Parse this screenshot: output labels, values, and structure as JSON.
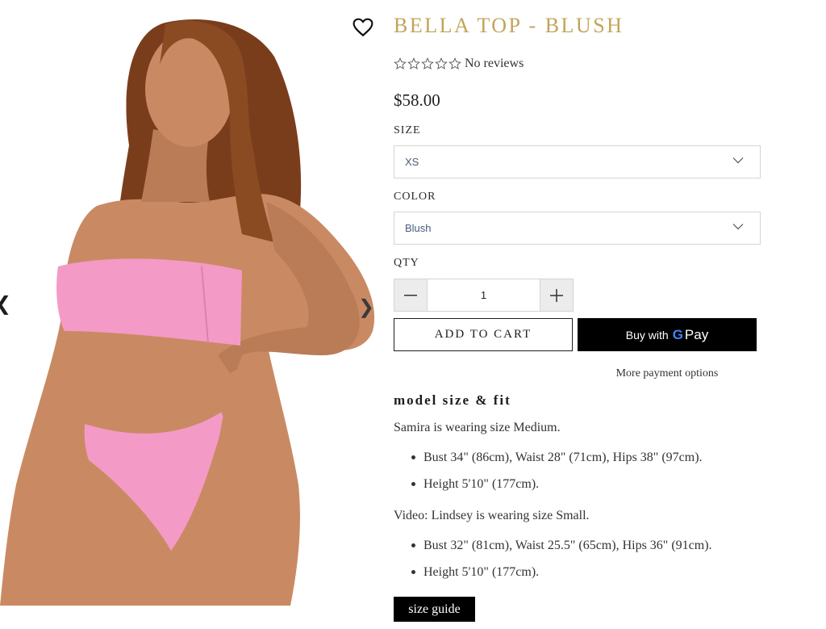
{
  "product": {
    "title": "BELLA TOP - BLUSH",
    "rating_stars": 5,
    "reviews_text": "No reviews",
    "price": "$58.00"
  },
  "icons": {
    "wishlist": "heart-outline-icon",
    "prev": "chevron-left-icon",
    "next": "chevron-right-icon",
    "star": "star-outline-icon",
    "dropdown": "chevron-down-icon",
    "minus": "minus-icon",
    "plus": "plus-icon"
  },
  "options": {
    "size_label": "SIZE",
    "size_value": "XS",
    "color_label": "COLOR",
    "color_value": "Blush",
    "qty_label": "QTY",
    "qty_value": "1"
  },
  "buttons": {
    "add_to_cart": "ADD TO CART",
    "buy_with": "Buy with",
    "gpay_g": "G",
    "gpay_pay": "Pay",
    "more_payment": "More payment options",
    "size_guide": "size guide"
  },
  "fit": {
    "heading": "model size & fit",
    "model1": "Samira is wearing size Medium.",
    "model1_bullets": [
      "Bust 34\" (86cm), Waist 28\" (71cm), Hips 38\" (97cm).",
      "Height 5'10\" (177cm)."
    ],
    "model2": "Video: Lindsey is wearing size Small.",
    "model2_bullets": [
      "Bust 32\" (81cm), Waist 25.5\" (65cm), Hips 36\" (91cm).",
      "Height 5'10\" (177cm)."
    ]
  },
  "colors": {
    "title_gold": "#c2a45a",
    "product_pink": "#f49ac6",
    "skin": "#c98a63",
    "hair": "#7a3d1c",
    "button_black": "#000000"
  }
}
